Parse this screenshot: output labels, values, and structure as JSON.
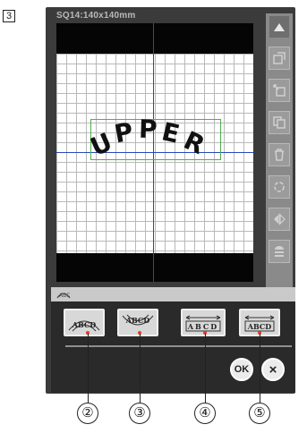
{
  "step_number": "3",
  "screen": {
    "hoop_label": "SQ14:140x140mm",
    "design_text": [
      "U",
      "P",
      "P",
      "E",
      "R"
    ]
  },
  "side_toolbar": {
    "buttons": [
      {
        "name": "scroll-up-icon"
      },
      {
        "name": "layout-icon"
      },
      {
        "name": "move-icon"
      },
      {
        "name": "copy-icon"
      },
      {
        "name": "delete-icon"
      },
      {
        "name": "rotate-icon"
      },
      {
        "name": "mirror-icon"
      },
      {
        "name": "stack-icon"
      }
    ]
  },
  "text_layout_panel": {
    "header_icon": "arc-text-icon",
    "buttons": [
      {
        "sample": "ABCD",
        "style": "arch-up",
        "callout": "②"
      },
      {
        "sample": "ABCD",
        "style": "arch-down",
        "callout": "③"
      },
      {
        "sample": "ABCD",
        "style": "spacing-wide",
        "callout": "④"
      },
      {
        "sample": "ABCD",
        "style": "spacing-narrow",
        "callout": "⑤"
      }
    ],
    "ok_label": "OK",
    "cancel_label": "×"
  },
  "colors": {
    "device_body": "#3b3b3b",
    "axis": "#2848b8",
    "design_frame": "#4fb04f",
    "callout_marker": "#e53b2b"
  }
}
